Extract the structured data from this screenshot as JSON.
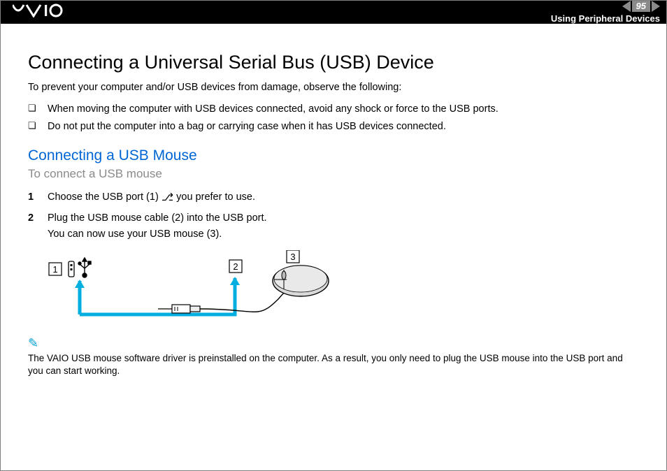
{
  "header": {
    "page_number": "95",
    "section": "Using Peripheral Devices"
  },
  "body": {
    "h1": "Connecting a Universal Serial Bus (USB) Device",
    "intro": "To prevent your computer and/or USB devices from damage, observe the following:",
    "bullets": [
      "When moving the computer with USB devices connected, avoid any shock or force to the USB ports.",
      "Do not put the computer into a bag or carrying case when it has USB devices connected."
    ],
    "h2": "Connecting a USB Mouse",
    "subhead": "To connect a USB mouse",
    "steps": {
      "s1a": "Choose the USB port (1) ",
      "s1b": " you prefer to use.",
      "s2a": "Plug the USB mouse cable (2) into the USB port.",
      "s2b": "You can now use your USB mouse (3)."
    },
    "diagram_labels": {
      "l1": "1",
      "l2": "2",
      "l3": "3"
    },
    "note": "The VAIO USB mouse software driver is preinstalled on the computer. As a result, you only need to plug the USB mouse into the USB port and you can start working."
  }
}
